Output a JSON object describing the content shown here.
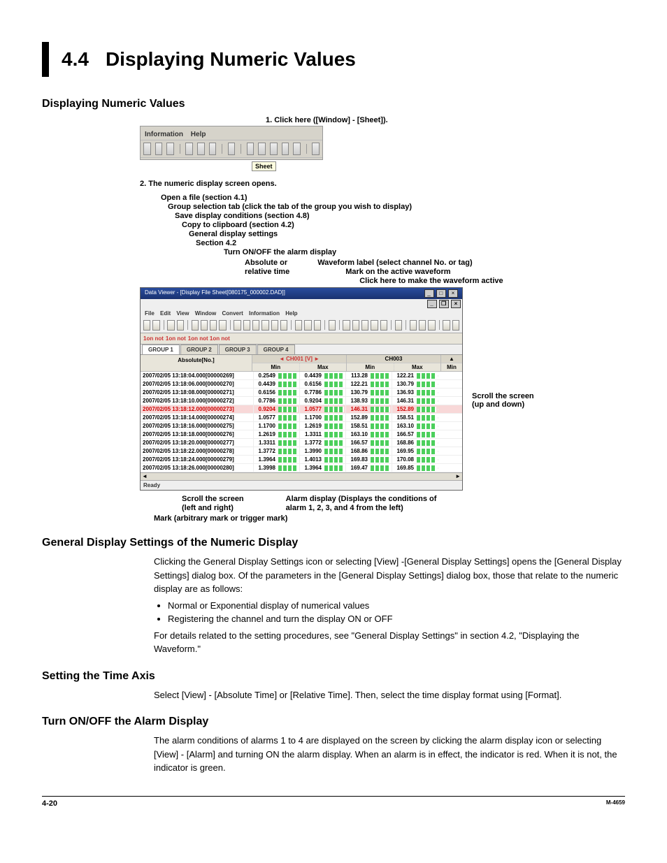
{
  "chapter": {
    "num": "4.4",
    "title": "Displaying Numeric Values"
  },
  "section1": {
    "heading": "Displaying Numeric Values"
  },
  "step1": "1. Click here ([Window] - [Sheet]).",
  "shot1": {
    "menu_information": "Information",
    "menu_help": "Help",
    "tooltip": "Sheet"
  },
  "step2": "2. The numeric display screen opens.",
  "callouts": {
    "c1": "Open a file (section 4.1)",
    "c2": "Group selection tab (click the tab of the group you wish to display)",
    "c3": "Save display conditions (section 4.8)",
    "c4": "Copy to clipboard (section 4.2)",
    "c5": "General display settings",
    "c6": "Section 4.2",
    "c7": "Turn ON/OFF the alarm display",
    "c8a": "Absolute or",
    "c8b": "relative time",
    "c9": "Waveform label (select channel No. or tag)",
    "c10": "Mark on the active waveform",
    "c11": "Click here to make the waveform active",
    "scroll_ud": "Scroll the screen",
    "scroll_ud2": "(up and down)",
    "scroll_lr": "Scroll the screen",
    "scroll_lr2": "(left and right)",
    "alarm_disp": "Alarm display (Displays the conditions of",
    "alarm_disp2": "alarm 1, 2, 3, and 4 from the left)",
    "mark": "Mark (arbitrary mark or trigger mark)"
  },
  "shot2": {
    "title": "Data Viewer - [Display File Sheet[080175_000002.DAD]]",
    "menu": [
      "File",
      "Edit",
      "View",
      "Window",
      "Convert",
      "Information",
      "Help"
    ],
    "tabs": [
      "GROUP 1",
      "GROUP 2",
      "GROUP 3",
      "GROUP 4"
    ],
    "head_time": "Absolute[No.]",
    "ch1": "CH001 [V]",
    "ch2": "CH003",
    "sub": [
      "Min",
      "Max",
      "Min",
      "Max",
      "Min"
    ],
    "rows": [
      {
        "t": "2007/02/05 13:18:04.000[00000269]",
        "v": [
          "0.2549",
          "0.4439",
          "113.28",
          "122.21"
        ],
        "a": false
      },
      {
        "t": "2007/02/05 13:18:06.000[00000270]",
        "v": [
          "0.4439",
          "0.6156",
          "122.21",
          "130.79"
        ],
        "a": false
      },
      {
        "t": "2007/02/05 13:18:08.000[00000271]",
        "v": [
          "0.6156",
          "0.7786",
          "130.79",
          "136.93"
        ],
        "a": false
      },
      {
        "t": "2007/02/05 13:18:10.000[00000272]",
        "v": [
          "0.7786",
          "0.9204",
          "138.93",
          "146.31"
        ],
        "a": false
      },
      {
        "t": "2007/02/05 13:18:12.000[00000273]",
        "v": [
          "0.9204",
          "1.0577",
          "146.31",
          "152.89"
        ],
        "a": true
      },
      {
        "t": "2007/02/05 13:18:14.000[00000274]",
        "v": [
          "1.0577",
          "1.1700",
          "152.89",
          "158.51"
        ],
        "a": false
      },
      {
        "t": "2007/02/05 13:18:16.000[00000275]",
        "v": [
          "1.1700",
          "1.2619",
          "158.51",
          "163.10"
        ],
        "a": false
      },
      {
        "t": "2007/02/05 13:18:18.000[00000276]",
        "v": [
          "1.2619",
          "1.3311",
          "163.10",
          "166.57"
        ],
        "a": false
      },
      {
        "t": "2007/02/05 13:18:20.000[00000277]",
        "v": [
          "1.3311",
          "1.3772",
          "166.57",
          "168.86"
        ],
        "a": false
      },
      {
        "t": "2007/02/05 13:18:22.000[00000278]",
        "v": [
          "1.3772",
          "1.3990",
          "168.86",
          "169.95"
        ],
        "a": false
      },
      {
        "t": "2007/02/05 13:18:24.000[00000279]",
        "v": [
          "1.3964",
          "1.4013",
          "169.83",
          "170.08"
        ],
        "a": false
      },
      {
        "t": "2007/02/05 13:18:26.000[00000280]",
        "v": [
          "1.3998",
          "1.3964",
          "169.47",
          "169.85"
        ],
        "a": false
      }
    ],
    "status": "Ready"
  },
  "section2": {
    "heading": "General Display Settings of the Numeric Display",
    "p1": "Clicking the General Display Settings icon or selecting [View] -[General Display Settings] opens the [General Display Settings] dialog box.  Of the parameters in the [General Display Settings] dialog box, those that relate to the numeric display are as follows:",
    "b1": "Normal or Exponential display of numerical values",
    "b2": "Registering the channel and turn the display ON or OFF",
    "p2": "For details related to the setting procedures, see \"General Display Settings\" in section 4.2, \"Displaying the Waveform.\""
  },
  "section3": {
    "heading": "Setting the Time Axis",
    "p1": "Select [View] - [Absolute Time] or [Relative Time].  Then, select the time display format using [Format]."
  },
  "section4": {
    "heading": "Turn ON/OFF the Alarm Display",
    "p1": "The alarm conditions of alarms 1 to 4 are displayed on the screen by clicking the alarm display icon or selecting [View] - [Alarm] and turning ON the alarm display.  When an alarm is in effect, the indicator is red.  When it is not, the indicator is green."
  },
  "footer": {
    "page": "4-20",
    "doc": "M-4659"
  }
}
